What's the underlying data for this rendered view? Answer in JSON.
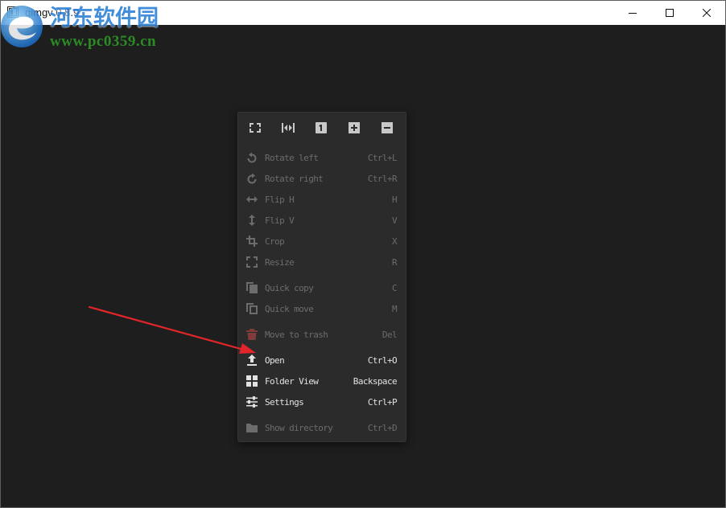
{
  "window": {
    "title": "qimgv 0.8.9",
    "app_icon": "qimgv-app-icon",
    "controls": [
      "minimize-icon",
      "maximize-icon",
      "close-icon"
    ]
  },
  "colors": {
    "title_bar": "#ffffff",
    "viewer_background": "#1e1e1e",
    "menu_background": "#2b2b2b",
    "menu_text": "#e2e2e2",
    "menu_text_disabled": "#6c6c6c",
    "toolbar_icon": "#c8c8c8",
    "trash_icon_disabled": "#803b3b",
    "annotation_arrow": "#e1252a",
    "watermark_text": "#2a7fd6",
    "watermark_url": "#2e9b27"
  },
  "context_menu": {
    "toolbar": [
      {
        "icon": "fit-window-icon"
      },
      {
        "icon": "fit-width-icon"
      },
      {
        "icon": "original-size-icon"
      },
      {
        "icon": "zoom-in-icon"
      },
      {
        "icon": "zoom-out-icon"
      }
    ],
    "sections": [
      {
        "items": [
          {
            "label": "Rotate left",
            "shortcut": "Ctrl+L",
            "icon": "rotate-left-icon",
            "enabled": false
          },
          {
            "label": "Rotate right",
            "shortcut": "Ctrl+R",
            "icon": "rotate-right-icon",
            "enabled": false
          },
          {
            "label": "Flip H",
            "shortcut": "H",
            "icon": "flip-horizontal-icon",
            "enabled": false
          },
          {
            "label": "Flip V",
            "shortcut": "V",
            "icon": "flip-vertical-icon",
            "enabled": false
          },
          {
            "label": "Crop",
            "shortcut": "X",
            "icon": "crop-icon",
            "enabled": false
          },
          {
            "label": "Resize",
            "shortcut": "R",
            "icon": "resize-icon",
            "enabled": false
          }
        ]
      },
      {
        "items": [
          {
            "label": "Quick copy",
            "shortcut": "C",
            "icon": "quick-copy-icon",
            "enabled": false
          },
          {
            "label": "Quick move",
            "shortcut": "M",
            "icon": "quick-move-icon",
            "enabled": false
          }
        ]
      },
      {
        "items": [
          {
            "label": "Move to trash",
            "shortcut": "Del",
            "icon": "trash-icon",
            "enabled": false
          }
        ]
      },
      {
        "items": [
          {
            "label": "Open",
            "shortcut": "Ctrl+O",
            "icon": "open-upload-icon",
            "enabled": true
          },
          {
            "label": "Folder View",
            "shortcut": "Backspace",
            "icon": "folder-view-grid-icon",
            "enabled": true
          },
          {
            "label": "Settings",
            "shortcut": "Ctrl+P",
            "icon": "settings-sliders-icon",
            "enabled": true
          }
        ]
      },
      {
        "items": [
          {
            "label": "Show directory",
            "shortcut": "Ctrl+D",
            "icon": "folder-icon",
            "enabled": false
          }
        ]
      }
    ]
  },
  "watermark": {
    "site_name": "河东软件园",
    "url": "www.pc0359.cn"
  }
}
